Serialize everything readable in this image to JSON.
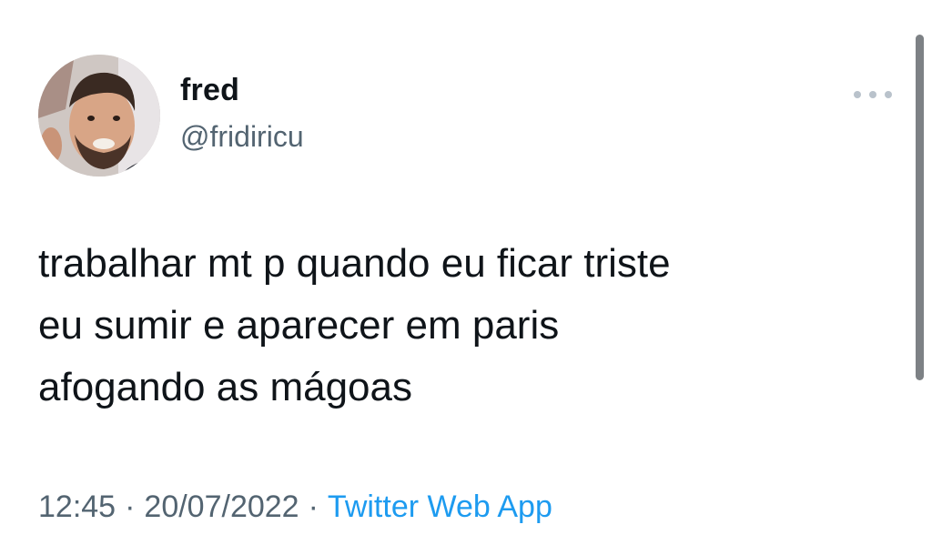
{
  "tweet": {
    "author": {
      "display_name": "fred",
      "handle": "@fridiricu",
      "avatar_icon": "profile-photo"
    },
    "more_icon": "more-horizontal-icon",
    "text_lines": [
      "trabalhar mt p quando eu ficar triste",
      "eu sumir e aparecer em paris",
      "afogando as mágoas"
    ],
    "time": "12:45",
    "date": "20/07/2022",
    "separator": "·",
    "source": "Twitter Web App"
  },
  "colors": {
    "text": "#0f1419",
    "secondary": "#536471",
    "link": "#1d9bf0",
    "more_dots": "#b9c2cb",
    "scrollbar": "#7d8185"
  }
}
